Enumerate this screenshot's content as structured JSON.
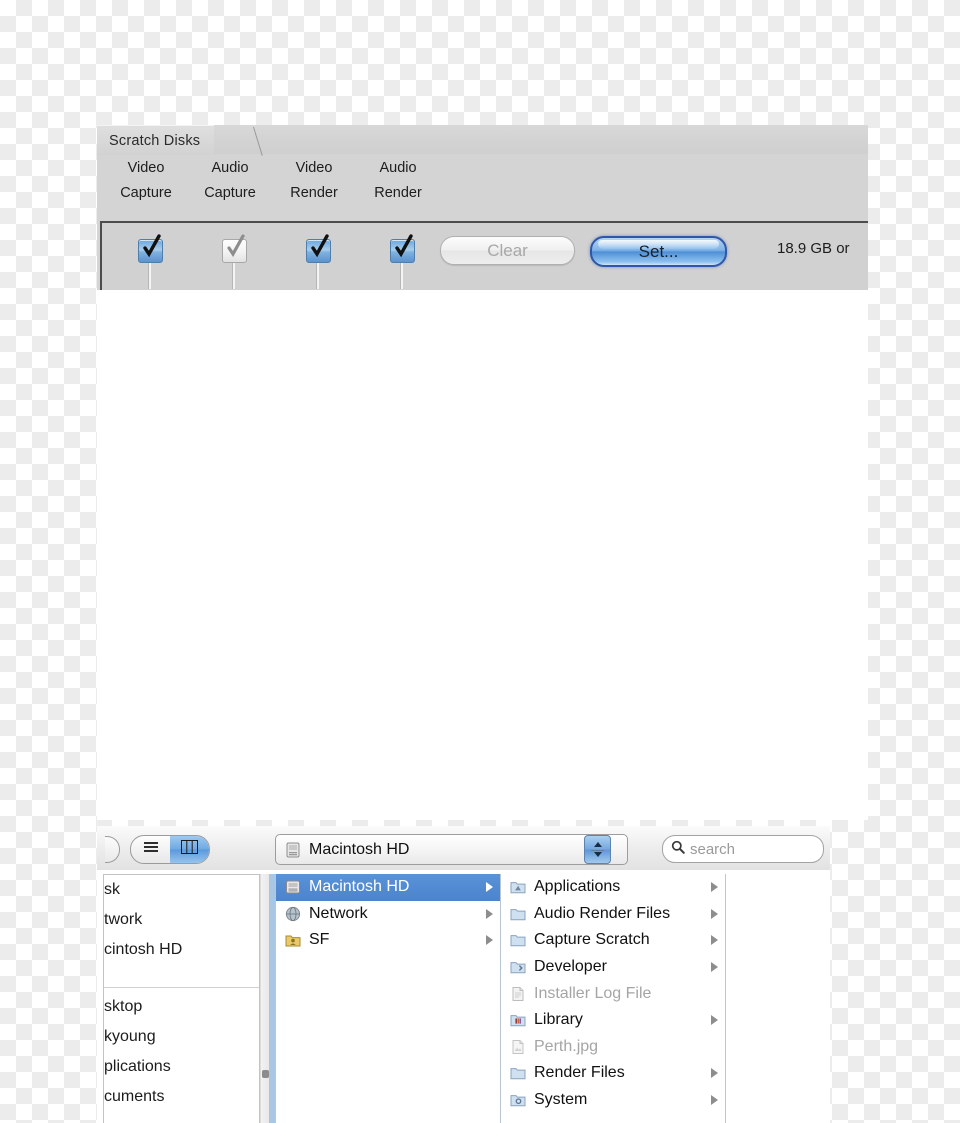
{
  "scratch_panel": {
    "tab_label": "Scratch Disks",
    "columns": [
      {
        "line1": "Video",
        "line2": "Capture",
        "checked": true,
        "enabled": true
      },
      {
        "line1": "Audio",
        "line2": "Capture",
        "checked": true,
        "enabled": false
      },
      {
        "line1": "Video",
        "line2": "Render",
        "checked": true,
        "enabled": true
      },
      {
        "line1": "Audio",
        "line2": "Render",
        "checked": true,
        "enabled": true
      }
    ],
    "clear_button": "Clear",
    "set_button": "Set...",
    "free_space": "18.9 GB or",
    "accent_blue": "#5b93d8",
    "panel_gray": "#d4d4d4"
  },
  "finder": {
    "toolbar": {
      "view_list_icon": "list-view-icon",
      "view_column_icon": "column-view-icon",
      "path_label": "Macintosh HD",
      "path_icon": "hard-drive-icon",
      "stepper_icon": "up-down-arrows-icon",
      "search_icon": "search-icon",
      "search_placeholder": "search",
      "search_value": ""
    },
    "sidebar": [
      {
        "label": "sk"
      },
      {
        "label": "twork"
      },
      {
        "label": "cintosh HD"
      }
    ],
    "sidebar_lower": [
      {
        "label": "sktop"
      },
      {
        "label": "kyoung"
      },
      {
        "label": "plications"
      },
      {
        "label": "cuments"
      }
    ],
    "column_a": [
      {
        "label": "Macintosh HD",
        "icon": "hard-drive-icon",
        "selected": true,
        "disclosure": true,
        "dim": false
      },
      {
        "label": "Network",
        "icon": "network-globe-icon",
        "selected": false,
        "disclosure": true,
        "dim": false
      },
      {
        "label": "SF",
        "icon": "user-folder-icon",
        "selected": false,
        "disclosure": true,
        "dim": false
      }
    ],
    "column_b": [
      {
        "label": "Applications",
        "icon": "applications-folder-icon",
        "disclosure": true,
        "dim": false
      },
      {
        "label": "Audio Render Files",
        "icon": "folder-icon",
        "disclosure": true,
        "dim": false
      },
      {
        "label": "Capture Scratch",
        "icon": "folder-icon",
        "disclosure": true,
        "dim": false
      },
      {
        "label": "Developer",
        "icon": "developer-folder-icon",
        "disclosure": true,
        "dim": false
      },
      {
        "label": "Installer Log File",
        "icon": "document-icon",
        "disclosure": false,
        "dim": true
      },
      {
        "label": "Library",
        "icon": "library-folder-icon",
        "disclosure": true,
        "dim": false
      },
      {
        "label": "Perth.jpg",
        "icon": "image-file-icon",
        "disclosure": false,
        "dim": true
      },
      {
        "label": "Render Files",
        "icon": "folder-icon",
        "disclosure": true,
        "dim": false
      },
      {
        "label": "System",
        "icon": "system-folder-icon",
        "disclosure": true,
        "dim": false
      }
    ]
  }
}
